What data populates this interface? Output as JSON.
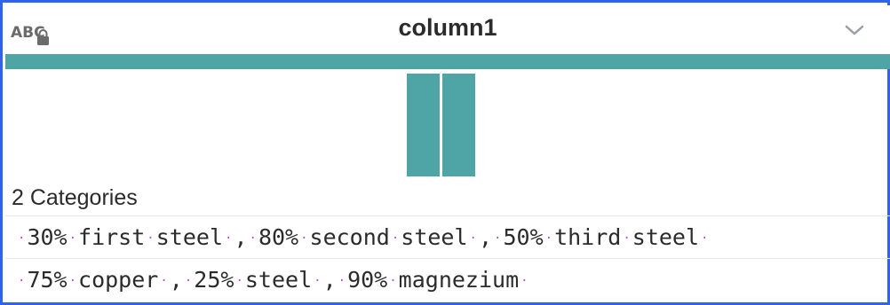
{
  "header": {
    "title": "column1",
    "type_icon": "abc-lock-icon",
    "menu_icon": "chevron-down-icon"
  },
  "quality_bar": {
    "color": "#4fa5a5",
    "valid_fraction": 1.0
  },
  "histogram": {
    "color": "#4fa5a5",
    "bars": [
      1,
      1
    ]
  },
  "summary": {
    "categories_label": "2 Categories"
  },
  "rows": [
    {
      "value": "30% first steel , 80% second steel , 50% third steel"
    },
    {
      "value": "75% copper , 25% steel , 90% magnezium"
    }
  ],
  "colors": {
    "accent": "#4fa5a5",
    "border": "#2f63ee",
    "whitespace_dot": "#b04fd6"
  }
}
